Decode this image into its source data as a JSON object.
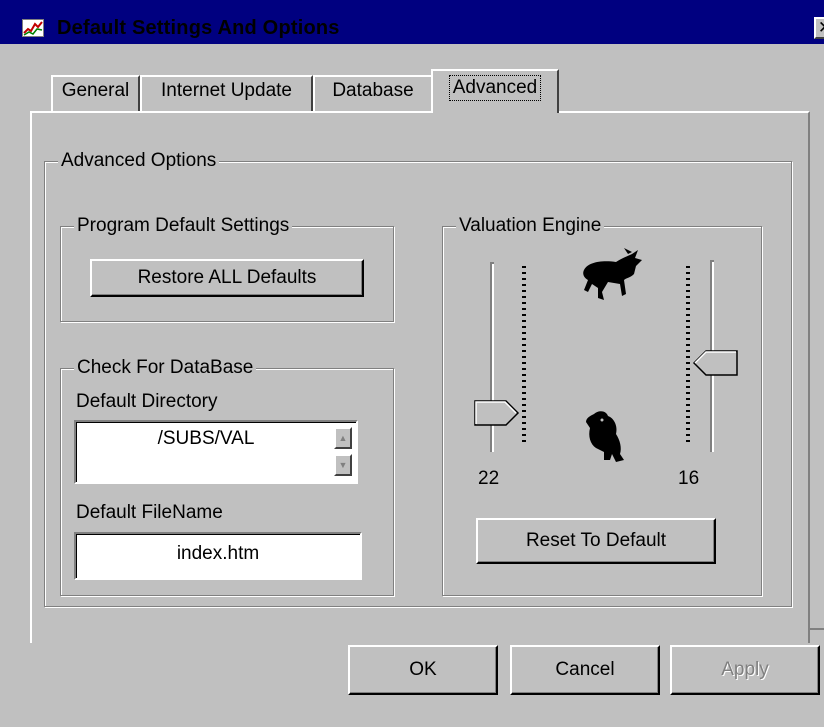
{
  "window": {
    "title": "Default Settings And Options",
    "close_glyph": "✕"
  },
  "tabs": [
    {
      "label": "General"
    },
    {
      "label": "Internet Update"
    },
    {
      "label": "Database"
    },
    {
      "label": "Advanced",
      "active": true
    }
  ],
  "advanced": {
    "group_label": "Advanced Options",
    "program_defaults": {
      "label": "Program Default Settings",
      "restore_button": "Restore ALL Defaults"
    },
    "check_db": {
      "label": "Check For DataBase",
      "dir_label": "Default Directory",
      "dir_value": "/SUBS/VAL",
      "file_label": "Default FileName",
      "file_value": "index.htm"
    },
    "valuation": {
      "label": "Valuation Engine",
      "bull_value": "22",
      "bear_value": "16",
      "reset_button": "Reset To Default"
    }
  },
  "footer": {
    "ok": "OK",
    "cancel": "Cancel",
    "apply": "Apply"
  },
  "colors": {
    "titlebar": "#000080",
    "face": "#c0c0c0"
  }
}
